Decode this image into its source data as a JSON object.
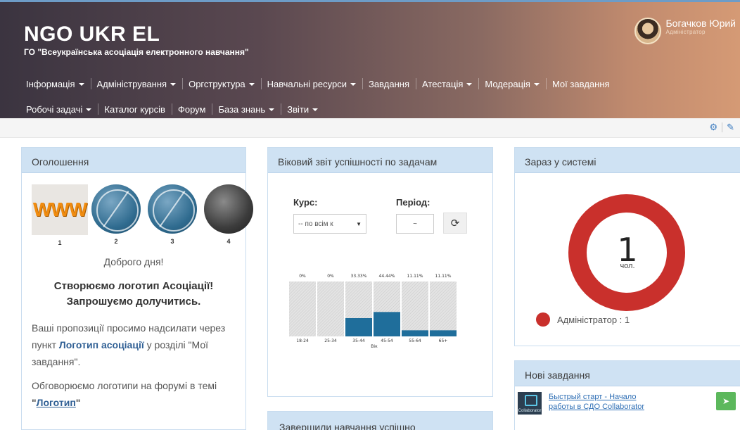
{
  "brand": {
    "title": "NGO UKR EL",
    "subtitle": "ГО \"Всеукраїнська асоціація електронного навчання\""
  },
  "user": {
    "name": "Богачков Юрий",
    "role": "Адміністратор"
  },
  "nav_row1": [
    {
      "label": "Інформація",
      "dropdown": true
    },
    {
      "label": "Адміністрування",
      "dropdown": true
    },
    {
      "label": "Оргструктура",
      "dropdown": true
    },
    {
      "label": "Навчальні ресурси",
      "dropdown": true
    },
    {
      "label": "Завдання",
      "dropdown": false
    },
    {
      "label": "Атестація",
      "dropdown": true
    },
    {
      "label": "Модерація",
      "dropdown": true
    },
    {
      "label": "Мої завдання",
      "dropdown": false
    }
  ],
  "nav_row2": [
    {
      "label": "Робочі задачі",
      "dropdown": true
    },
    {
      "label": "Каталог курсів",
      "dropdown": false
    },
    {
      "label": "Форум",
      "dropdown": false
    },
    {
      "label": "База знань",
      "dropdown": true
    },
    {
      "label": "Звіти",
      "dropdown": true
    }
  ],
  "toolbar": {
    "icons": [
      "settings-icon",
      "edit-icon"
    ]
  },
  "announcements": {
    "title": "Оголошення",
    "logos": [
      {
        "num": "1",
        "icon": "www-logo",
        "tag": "WWW"
      },
      {
        "num": "2",
        "icon": "globe-logo"
      },
      {
        "num": "3",
        "icon": "globe-logo"
      },
      {
        "num": "4",
        "icon": "globe-dark-logo"
      }
    ],
    "greeting": "Доброго дня!",
    "headline_1": "Створюємо логотип Асоціації!",
    "headline_2": "Запрошуємо долучитись.",
    "para1_start": "Ваші пропозиції просимо надсилати через пункт ",
    "para1_link": "Логотип асоціації",
    "para1_end": " у розділі \"Мої завдання\".",
    "para2_start": "Обговорюємо логотипи на форумі в темі ",
    "para2_quote_open": "\"",
    "para2_link": "Логотип",
    "para2_quote_close": "\""
  },
  "age_report": {
    "title": "Віковий звіт успішності по задачам",
    "course_label": "Курс:",
    "course_value": "-- по всім к",
    "period_label": "Період:",
    "period_value": "~"
  },
  "chart_data": {
    "type": "bar",
    "xlabel": "Вік",
    "categories": [
      "18-24",
      "25-34",
      "35-44",
      "45-54",
      "55-64",
      "65+"
    ],
    "values": [
      0,
      0,
      33.33,
      44.44,
      11.11,
      11.11
    ],
    "value_labels": [
      "0%",
      "0%",
      "33.33%",
      "44.44%",
      "11.11%",
      "11.11%"
    ],
    "ylim": [
      0,
      100
    ],
    "bar_color": "#1f6e9b",
    "track_color": "#dcdcdc"
  },
  "completed_panel": {
    "title": "Завершили навчання успішно"
  },
  "online": {
    "title": "Зараз у системі",
    "count": "1",
    "unit": "чол.",
    "legend": "Адміністратор : 1",
    "ring_color": "#c9302c"
  },
  "new_tasks": {
    "title": "Нові завдання",
    "items": [
      {
        "title": "Быстрый старт - Начало работы в СДО Collaborator",
        "thumb_label": "Collaborator"
      }
    ]
  }
}
